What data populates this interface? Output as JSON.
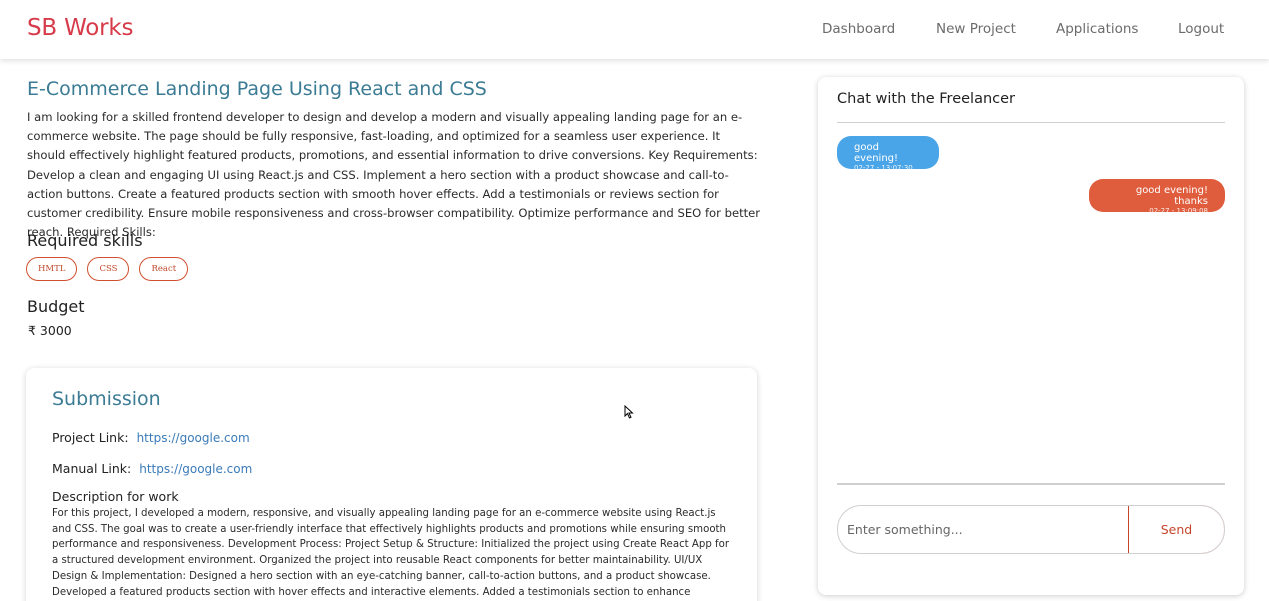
{
  "navbar": {
    "brand": "SB Works",
    "links": [
      "Dashboard",
      "New Project",
      "Applications",
      "Logout"
    ]
  },
  "project": {
    "title": "E-Commerce Landing Page Using React and CSS",
    "description": "I am looking for a skilled frontend developer to design and develop a modern and visually appealing landing page for an e-commerce website. The page should be fully responsive, fast-loading, and optimized for a seamless user experience. It should effectively highlight featured products, promotions, and essential information to drive conversions. Key Requirements: Develop a clean and engaging UI using React.js and CSS. Implement a hero section with a product showcase and call-to-action buttons. Create a featured products section with smooth hover effects. Add a testimonials or reviews section for customer credibility. Ensure mobile responsiveness and cross-browser compatibility. Optimize performance and SEO for better reach. Required Skills:",
    "skills_heading": "Required skills",
    "skills": [
      "HMTL",
      "CSS",
      "React"
    ],
    "budget_heading": "Budget",
    "budget_value": "₹ 3000"
  },
  "submission": {
    "title": "Submission",
    "project_link_label": "Project Link:",
    "project_link": "https://google.com",
    "manual_link_label": "Manual Link:",
    "manual_link": "https://google.com",
    "description_label": "Description for work",
    "description": "For this project, I developed a modern, responsive, and visually appealing landing page for an e-commerce website using React.js and CSS. The goal was to create a user-friendly interface that effectively highlights products and promotions while ensuring smooth performance and responsiveness. Development Process: Project Setup & Structure: Initialized the project using Create React App for a structured development environment. Organized the project into reusable React components for better maintainability. UI/UX Design & Implementation: Designed a hero section with an eye-catching banner, call-to-action buttons, and a product showcase. Developed a featured products section with hover effects and interactive elements. Added a testimonials section to enhance credibility and trust. Designed a simple and intuitive navigation bar"
  },
  "chat": {
    "title": "Chat with the Freelancer",
    "messages": [
      {
        "direction": "incoming",
        "text": "good evening!",
        "time": "02-27 - 13:07:30"
      },
      {
        "direction": "outgoing",
        "text": "good evening! thanks",
        "time": "02-27 - 13:09:08"
      }
    ],
    "input_placeholder": "Enter something...",
    "send_label": "Send",
    "colors": {
      "incoming": "#4aa5e8",
      "outgoing": "#df5c3c"
    }
  },
  "colors": {
    "brand": "#d73a49",
    "heading_accent": "#3b7b94",
    "link": "#3a7bb8"
  }
}
